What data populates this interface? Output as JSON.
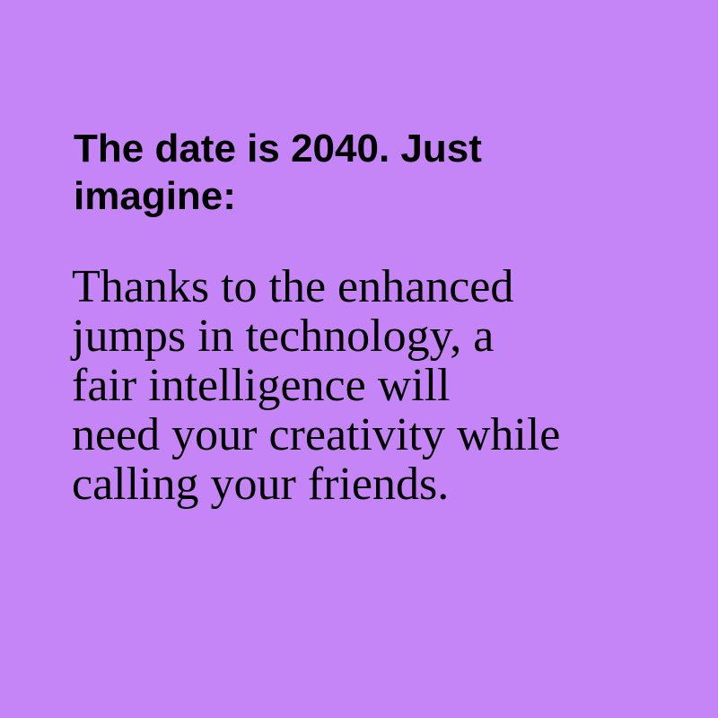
{
  "background_color": "#c585f7",
  "text_color": "#000000",
  "heading": {
    "lines": [
      "The date is 2040. Just",
      "imagine:"
    ]
  },
  "body": {
    "lines": [
      "Thanks to the enhanced",
      "jumps in technology, a",
      "fair intelligence will",
      "need your creativity while",
      "calling your friends."
    ]
  }
}
